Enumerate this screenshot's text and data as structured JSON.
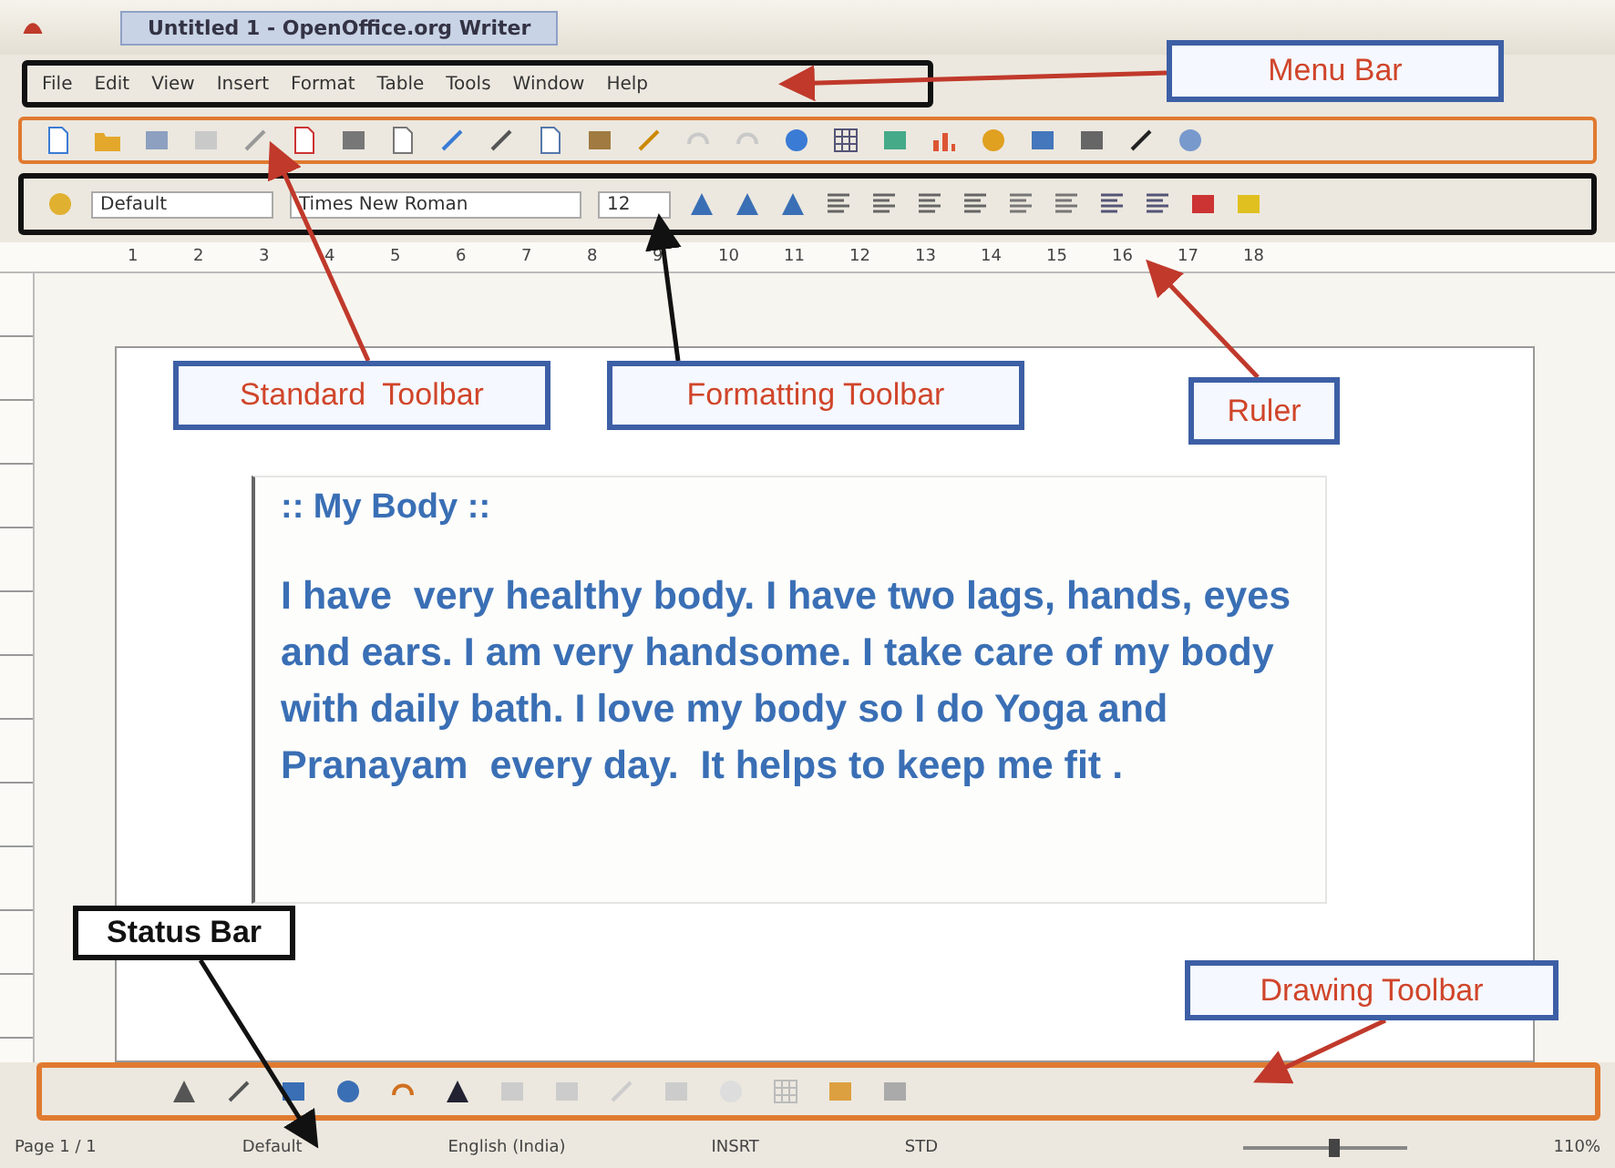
{
  "window": {
    "title": "Untitled 1 - OpenOffice.org Writer"
  },
  "menu_bar": [
    "File",
    "Edit",
    "View",
    "Insert",
    "Format",
    "Table",
    "Tools",
    "Window",
    "Help"
  ],
  "formatting_toolbar": {
    "style": "Default",
    "font": "Times New Roman",
    "size": "12"
  },
  "ruler": [
    "1",
    "2",
    "3",
    "4",
    "5",
    "6",
    "7",
    "8",
    "9",
    "10",
    "11",
    "12",
    "13",
    "14",
    "15",
    "16",
    "17",
    "18"
  ],
  "document": {
    "heading": ":: My Body ::",
    "body": "I have  very healthy body. I have two lags, hands, eyes and ears. I am very handsome. I take care of my body with daily bath. I love my body so I do Yoga and Pranayam  every day.  It helps to keep me fit ."
  },
  "status_bar": [
    "Page 1 / 1",
    "Default",
    "English (India)",
    "INSRT",
    "STD"
  ],
  "zoom": {
    "level": 0.55,
    "reading": "110%"
  },
  "annotations": [
    {
      "label": "Menu Bar",
      "kind": "framed"
    },
    {
      "label": "Standard  Toolbar",
      "kind": "framed"
    },
    {
      "label": "Formatting Toolbar",
      "kind": "framed"
    },
    {
      "label": "Ruler",
      "kind": "framed"
    },
    {
      "label": "Status Bar",
      "kind": "plain"
    },
    {
      "label": "Drawing Toolbar",
      "kind": "framed"
    }
  ]
}
